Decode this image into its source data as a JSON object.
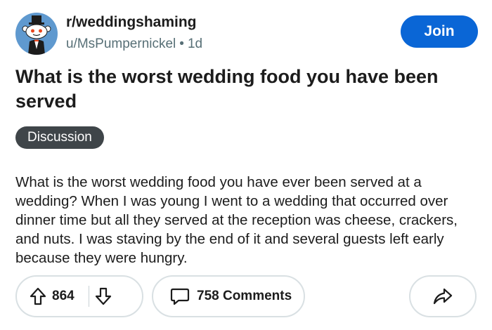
{
  "post": {
    "subreddit": "r/weddingshaming",
    "author": "u/MsPumpernickel",
    "separator": "•",
    "age": "1d",
    "join_label": "Join",
    "title": "What is the worst wedding food you have been served",
    "flair": "Discussion",
    "body": "What is the worst wedding food you have ever been served at a wedding? When I was young I went to a wedding that occurred over dinner time but all they served at the reception was cheese, crackers, and nuts. I was staving by the end of it and several guests left early because they were hungry."
  },
  "actions": {
    "vote_count": "864",
    "comments_label": "758 Comments"
  },
  "icons": {
    "avatar": "snoo-tuxedo-avatar",
    "upvote": "upvote-arrow-icon",
    "downvote": "downvote-arrow-icon",
    "comment": "comment-bubble-icon",
    "share": "share-arrow-icon"
  },
  "colors": {
    "join_button": "#0a66d6",
    "flair_bg": "#3f4549",
    "meta_text": "#576f76",
    "avatar_bg": "#5f99cf"
  }
}
